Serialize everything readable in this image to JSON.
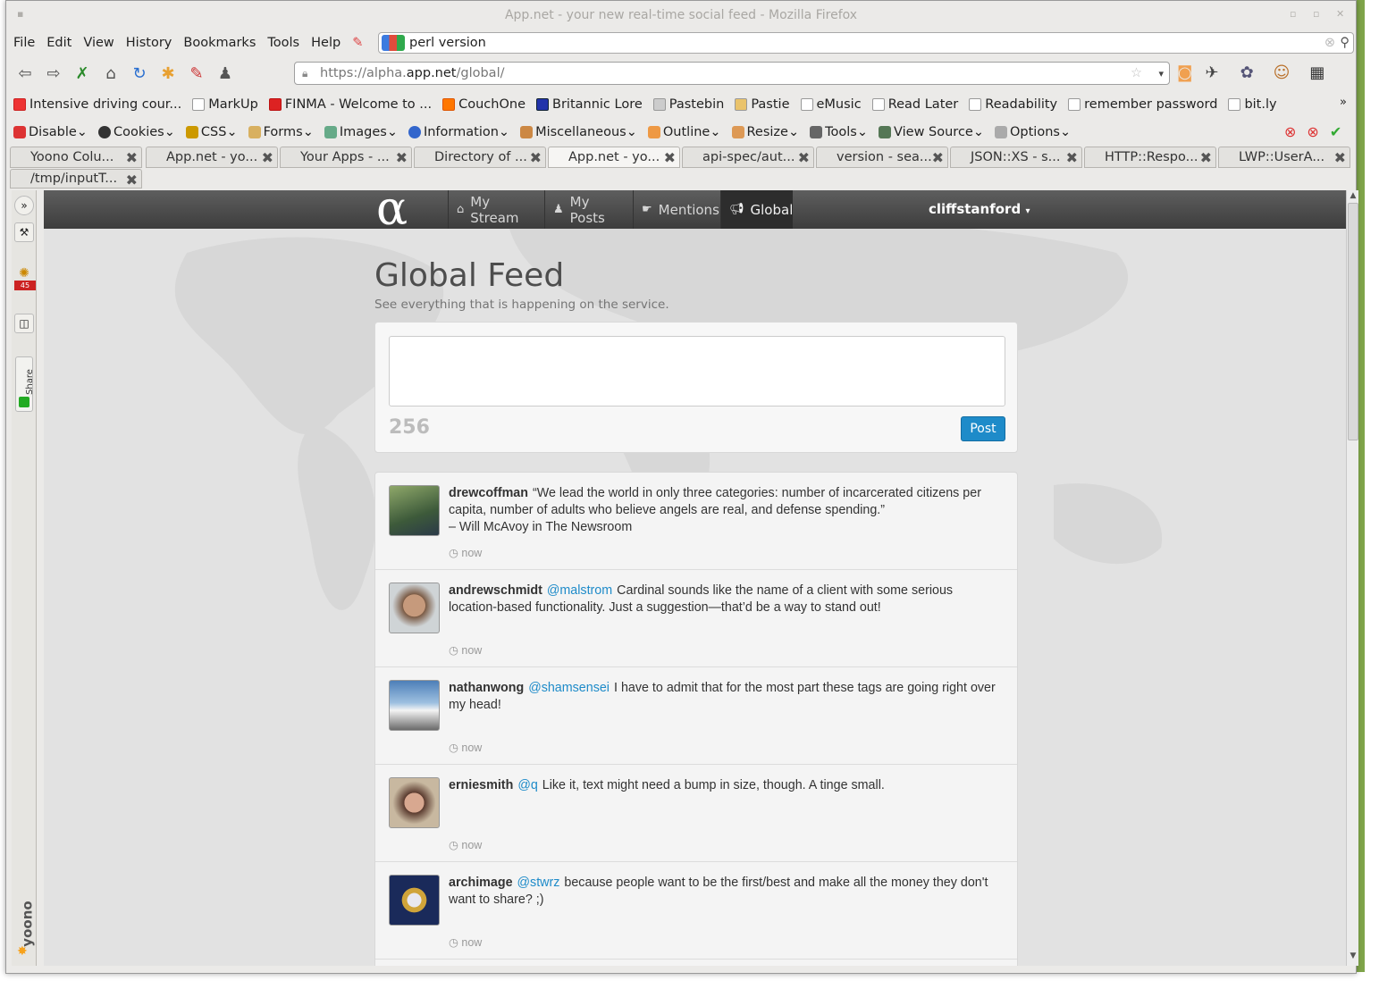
{
  "window": {
    "title": "App.net - your new real-time social feed - Mozilla Firefox"
  },
  "menu": [
    "File",
    "Edit",
    "View",
    "History",
    "Bookmarks",
    "Tools",
    "Help"
  ],
  "search": {
    "value": "perl version"
  },
  "url": {
    "prefix": "https://alpha.",
    "host": "app.net",
    "path": "/global/"
  },
  "bookmarks": [
    "Intensive driving cour...",
    "MarkUp",
    "FINMA - Welcome to ...",
    "CouchOne",
    "Britannic Lore",
    "Pastebin",
    "Pastie",
    "eMusic",
    "Read Later",
    "Readability",
    "remember password",
    "bit.ly"
  ],
  "devtoolbar": [
    "Disable",
    "Cookies",
    "CSS",
    "Forms",
    "Images",
    "Information",
    "Miscellaneous",
    "Outline",
    "Resize",
    "Tools",
    "View Source",
    "Options"
  ],
  "tabs": [
    "Yoono Colu...",
    "App.net - yo...",
    "Your Apps - ...",
    "Directory of ...",
    "App.net - yo...",
    "api-spec/aut...",
    "version - sea...",
    "JSON::XS - s...",
    "HTTP::Respo...",
    "LWP::UserA...",
    "/tmp/inputT..."
  ],
  "sidebar": {
    "badge": "45",
    "share": "Share",
    "yoono": "yoono"
  },
  "appnav": {
    "logo": "α",
    "tabs": [
      "My Stream",
      "My Posts",
      "Mentions",
      "Global"
    ],
    "user": "cliffstanford"
  },
  "page": {
    "title": "Global Feed",
    "subtitle": "See everything that is happening on the service."
  },
  "composer": {
    "count": "256",
    "post": "Post"
  },
  "posts": [
    {
      "user": "drewcoffman",
      "mention": "",
      "text": "“We lead the world in only three categories: number of incarcerated citizens per capita, number of adults who believe angels are real, and defense spending.”",
      "text2": "– Will McAvoy in The Newsroom",
      "time": "now"
    },
    {
      "user": "andrewschmidt",
      "mention": "@malstrom",
      "text": "Cardinal sounds like the name of a client with some serious location-based functionality. Just a suggestion—that’d be a way to stand out!",
      "text2": "",
      "time": "now"
    },
    {
      "user": "nathanwong",
      "mention": "@shamsensei",
      "text": "I have to admit that for the most part these tags are going right over my head!",
      "text2": "",
      "time": "now"
    },
    {
      "user": "erniesmith",
      "mention": "@q",
      "text": "Like it, text might need a bump in size, though. A tinge small.",
      "text2": "",
      "time": "now"
    },
    {
      "user": "archimage",
      "mention": "@stwrz",
      "text": "because people want to be the first/best and make all the money they don't want to share? ;)",
      "text2": "",
      "time": "now"
    }
  ],
  "colors": {
    "accent": "#1e8bc9",
    "navbar": "#4a4a4a"
  }
}
